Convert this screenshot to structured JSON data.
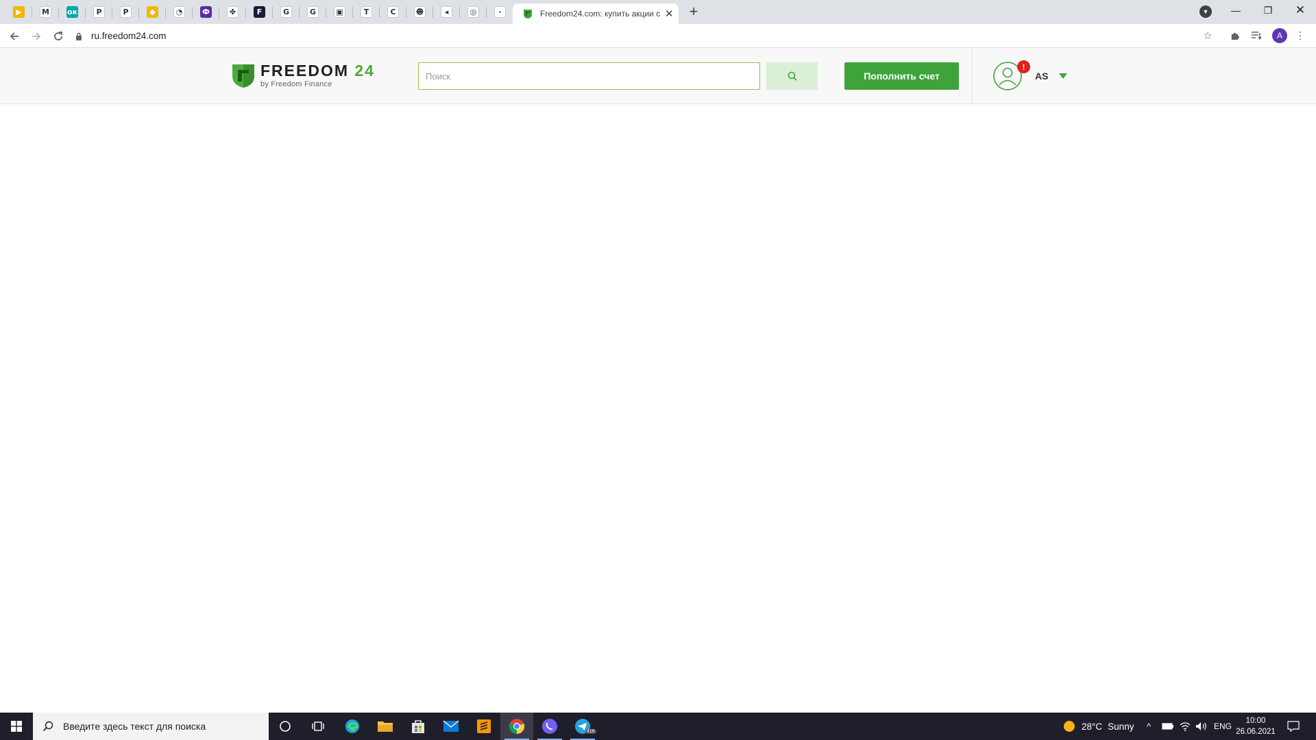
{
  "browser": {
    "pinned_tabs": [
      {
        "name": "google-keep-tab",
        "icon": "yellow-play-icon",
        "color": "#f4b400",
        "glyph": "▶"
      },
      {
        "name": "gmail-tab",
        "icon": "gmail-icon",
        "color": "#ffffff",
        "glyph": "M"
      },
      {
        "name": "ok-tab",
        "icon": "ok-icon",
        "color": "#00a6a6",
        "glyph": "ок"
      },
      {
        "name": "p-tab-1",
        "icon": "p-logo-icon",
        "color": "#ffffff",
        "glyph": "P"
      },
      {
        "name": "p-tab-2",
        "icon": "p-blue-logo-icon",
        "color": "#ffffff",
        "glyph": "P"
      },
      {
        "name": "binance-tab",
        "icon": "binance-icon",
        "color": "#f0b90b",
        "glyph": "◆"
      },
      {
        "name": "gauge-tab",
        "icon": "gauge-icon",
        "color": "#ffffff",
        "glyph": "◔"
      },
      {
        "name": "purple-tab",
        "icon": "purple-logo-icon",
        "color": "#5a2ca0",
        "glyph": "Ф"
      },
      {
        "name": "green-tab",
        "icon": "green-cross-icon",
        "color": "#ffffff",
        "glyph": "✤"
      },
      {
        "name": "f-tab",
        "icon": "f-logo-icon",
        "color": "#1a1a3a",
        "glyph": "F"
      },
      {
        "name": "google-tab-1",
        "icon": "google-icon",
        "color": "#ffffff",
        "glyph": "G"
      },
      {
        "name": "google-tab-2",
        "icon": "google-icon",
        "color": "#ffffff",
        "glyph": "G"
      },
      {
        "name": "chart-tab",
        "icon": "chart-box-icon",
        "color": "#ffffff",
        "glyph": "▣"
      },
      {
        "name": "t-tab",
        "icon": "t-logo-icon",
        "color": "#ffffff",
        "glyph": "T"
      },
      {
        "name": "c-tab",
        "icon": "c-logo-icon",
        "color": "#ffffff",
        "glyph": "C"
      },
      {
        "name": "avatar-tab",
        "icon": "face-icon",
        "color": "#ffffff",
        "glyph": "☻"
      },
      {
        "name": "audio-tab",
        "icon": "speaker-icon",
        "color": "#ffffff",
        "glyph": "◂"
      },
      {
        "name": "circle-tab",
        "icon": "circle-logo-icon",
        "color": "#ffffff",
        "glyph": "◎"
      },
      {
        "name": "loading-tab",
        "icon": "loading-icon",
        "color": "#ffffff",
        "glyph": "·"
      }
    ],
    "active_tab": {
      "title": "Freedom24.com: купить акции с",
      "close": "✕"
    },
    "new_tab_glyph": "+",
    "url": "ru.freedom24.com",
    "profile_initial": "A"
  },
  "site": {
    "logo": {
      "main": "FREEDOM",
      "num": "24",
      "sub": "by Freedom Finance"
    },
    "search_placeholder": "Поиск",
    "topup_label": "Пополнить счет",
    "user": {
      "initials": "AS",
      "alert": "!"
    },
    "colors": {
      "brand_green": "#3ea43a",
      "alert_red": "#e32219"
    }
  },
  "taskbar": {
    "search_placeholder": "Введите здесь текст для поиска",
    "weather": {
      "temp": "28°C",
      "condition": "Sunny"
    },
    "lang": "ENG",
    "time": "10:00",
    "date": "26.06.2021",
    "telegram_badge": "416"
  }
}
